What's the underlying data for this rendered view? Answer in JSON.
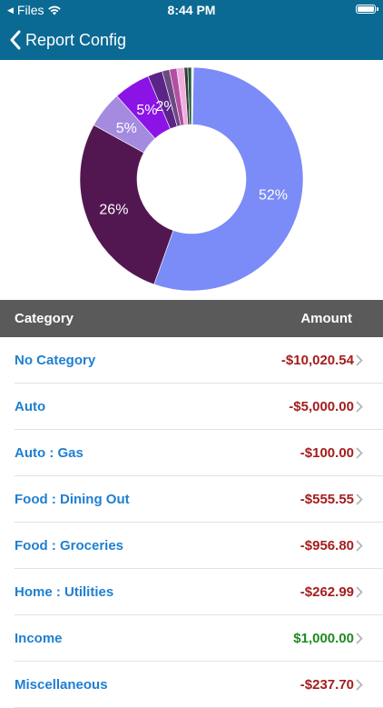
{
  "status_bar": {
    "back_app": "Files",
    "time": "8:44 PM"
  },
  "nav": {
    "back_label": "Report Config"
  },
  "table": {
    "header_category": "Category",
    "header_amount": "Amount",
    "rows": [
      {
        "category": "No Category",
        "amount": "-$10,020.54",
        "sign": "neg"
      },
      {
        "category": "Auto",
        "amount": "-$5,000.00",
        "sign": "neg"
      },
      {
        "category": "Auto : Gas",
        "amount": "-$100.00",
        "sign": "neg"
      },
      {
        "category": "Food : Dining Out",
        "amount": "-$555.55",
        "sign": "neg"
      },
      {
        "category": "Food : Groceries",
        "amount": "-$956.80",
        "sign": "neg"
      },
      {
        "category": "Home : Utilities",
        "amount": "-$262.99",
        "sign": "neg"
      },
      {
        "category": "Income",
        "amount": "$1,000.00",
        "sign": "pos"
      },
      {
        "category": "Miscellaneous",
        "amount": "-$237.70",
        "sign": "neg"
      }
    ]
  },
  "chart_data": {
    "type": "pie",
    "donut": true,
    "slices": [
      {
        "value": 52,
        "label": "52%",
        "color": "#7b8bf7"
      },
      {
        "value": 26,
        "label": "26%",
        "color": "#521750"
      },
      {
        "value": 5,
        "label": "5%",
        "color": "#a48be0"
      },
      {
        "value": 5,
        "label": "5%",
        "color": "#8b13e6"
      },
      {
        "value": 2,
        "label": "2%",
        "color": "#5b2489"
      },
      {
        "value": 1,
        "label": "",
        "color": "#6b4a82"
      },
      {
        "value": 1,
        "label": "",
        "color": "#b24fa2"
      },
      {
        "value": 1,
        "label": "",
        "color": "#f0aee0"
      },
      {
        "value": 0.5,
        "label": "",
        "color": "#3a3a3a"
      },
      {
        "value": 0.5,
        "label": "",
        "color": "#1f5a3a"
      }
    ],
    "colors": {
      "nav": "#0b6a93",
      "header": "#5a5a5a",
      "link": "#1f7fd1",
      "negative": "#a51d1d",
      "positive": "#1f8a1f"
    }
  }
}
